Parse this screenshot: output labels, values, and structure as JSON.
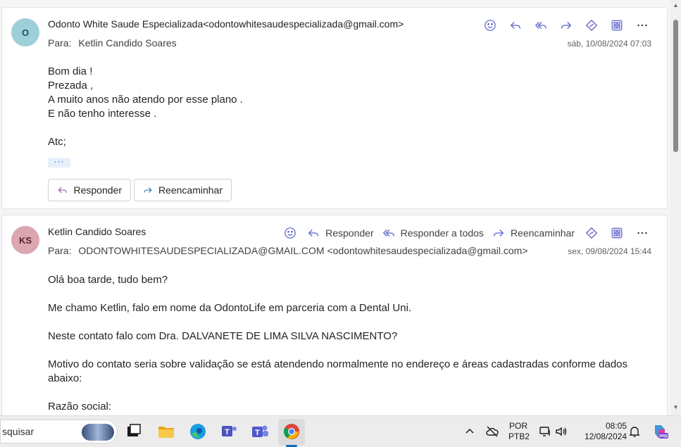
{
  "emails": [
    {
      "avatar_initials": "O",
      "sender": "Odonto White Saude Especializada<odontowhitesaudespecializada@gmail.com>",
      "to_label": "Para:",
      "to_value": "Ketlin Candido Soares",
      "date": "sáb, 10/08/2024 07:03",
      "body_lines": [
        "Bom dia !",
        "Prezada ,",
        "A muito anos não atendo por esse plano .",
        "E não tenho interesse ."
      ],
      "signoff": "Atc;",
      "more_label": "···",
      "reply_button": "Responder",
      "forward_button": "Reencaminhar"
    },
    {
      "avatar_initials": "KS",
      "sender": "Ketlin Candido Soares",
      "to_label": "Para:",
      "to_value": "ODONTOWHITESAUDESPECIALIZADA@GMAIL.COM <odontowhitesaudespecializada@gmail.com>",
      "date": "sex, 09/08/2024 15:44",
      "actions": {
        "reply": "Responder",
        "reply_all": "Responder a todos",
        "forward": "Reencaminhar"
      },
      "paragraphs": [
        "Olá boa tarde, tudo bem?",
        "Me chamo Ketlin, falo em nome da OdontoLife em parceria com a Dental Uni.",
        "Neste contato falo com Dra. DALVANETE DE LIMA SILVA NASCIMENTO?",
        "Motivo do contato seria sobre validação se está atendendo normalmente no endereço e áreas cadastradas conforme dados abaixo:",
        "Razão social:"
      ]
    }
  ],
  "taskbar": {
    "search_text": "squisar",
    "language_top": "POR",
    "language_bottom": "PTB2",
    "time": "08:05",
    "date": "12/08/2024"
  },
  "colors": {
    "accent": "#5b5fc7",
    "avatar_o": "#9ecfd9",
    "avatar_ks": "#dba7b0"
  }
}
